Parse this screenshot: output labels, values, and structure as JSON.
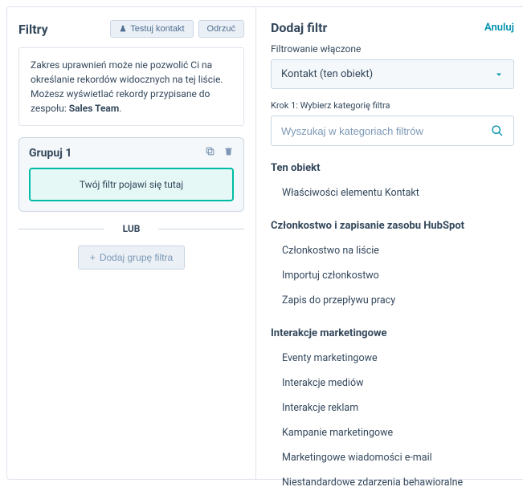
{
  "left": {
    "title": "Filtry",
    "testBtn": "Testuj kontakt",
    "rejectBtn": "Odrzuć",
    "infoText": "Zakres uprawnień może nie pozwolić Ci na określanie rekordów widocznych na tej liście. Możesz wyświetlać rekordy przypisane do zespołu: ",
    "infoBold": "Sales Team",
    "group": {
      "title": "Grupuj 1",
      "placeholder": "Twój filtr pojawi się tutaj"
    },
    "orLabel": "LUB",
    "addGroup": "Dodaj grupę filtra"
  },
  "right": {
    "title": "Dodaj filtr",
    "cancel": "Anuluj",
    "filteringOnLabel": "Filtrowanie włączone",
    "selectedObject": "Kontakt (ten obiekt)",
    "stepLabel": "Krok 1: Wybierz kategorię filtra",
    "searchPlaceholder": "Wyszukaj w kategoriach filtrów",
    "categories": [
      {
        "head": "Ten obiekt",
        "items": [
          "Właściwości elementu Kontakt"
        ]
      },
      {
        "head": "Członkostwo i zapisanie zasobu HubSpot",
        "items": [
          "Członkostwo na liście",
          "Importuj członkostwo",
          "Zapis do przepływu pracy"
        ]
      },
      {
        "head": "Interakcje marketingowe",
        "items": [
          "Eventy marketingowe",
          "Interakcje mediów",
          "Interakcje reklam",
          "Kampanie marketingowe",
          "Marketingowe wiadomości e-mail",
          "Niestandardowe zdarzenia behawioralne"
        ]
      }
    ]
  }
}
